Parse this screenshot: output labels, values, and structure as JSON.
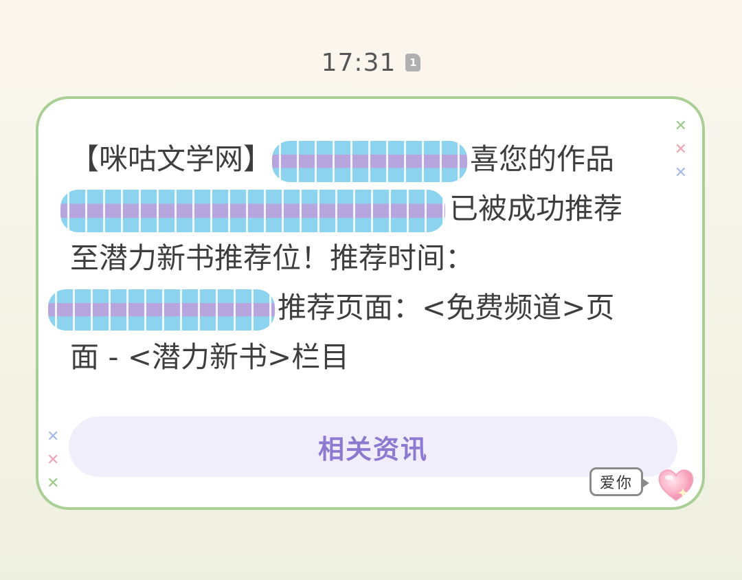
{
  "status": {
    "time": "17:31",
    "sim_slot": "1"
  },
  "message": {
    "line1_sender": "【咪咕文学网】",
    "line1_tail": "喜您的作品",
    "line2_tail": "已被成功推荐",
    "line3": "至潜力新书推荐位！推荐时间：",
    "line4_tail": "推荐页面：<免费频道>页",
    "line5": "面 - <潜力新书>栏目"
  },
  "actions": {
    "related_label": "相关资讯",
    "love_label": "爱你"
  },
  "icons": {
    "heart": "heart-sparkle-icon",
    "sim": "sim-card-icon"
  },
  "colors": {
    "card_border": "#a9cf94",
    "button_bg": "#f1eefb",
    "button_text": "#8b7ad0"
  }
}
